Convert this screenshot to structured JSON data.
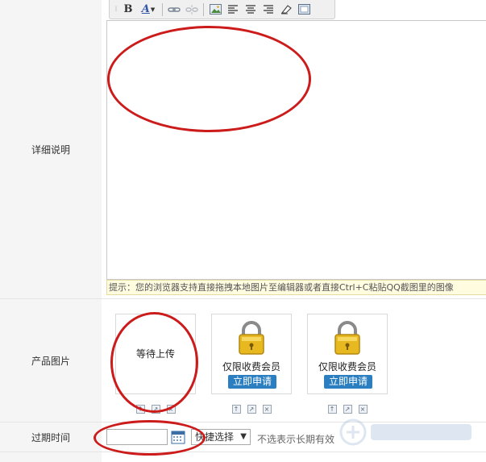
{
  "editor": {
    "toolbar": {
      "bold": "B",
      "font_color": "A",
      "icons": [
        "link-icon",
        "unlink-icon",
        "image-icon",
        "align-left-icon",
        "align-center-icon",
        "align-right-icon",
        "eraser-icon",
        "source-icon"
      ]
    },
    "hint": "提示：您的浏览器支持直接拖拽本地图片至编辑器或者直接Ctrl+C粘贴QQ截图里的图像"
  },
  "labels": {
    "detail": "详细说明",
    "product_images": "产品图片",
    "expire_time": "过期时间"
  },
  "images": [
    {
      "status": "等待上传"
    },
    {
      "text": "仅限收费会员",
      "button": "立即申请"
    },
    {
      "text": "仅限收费会员",
      "button": "立即申请"
    }
  ],
  "expire": {
    "date_value": "",
    "quick_select": "快捷选择",
    "note": "不选表示长期有效"
  },
  "colors": {
    "annotation_red": "#cc1b1b",
    "apply_button": "#2b7fc0",
    "label_bg": "#f5f5f5",
    "hint_bg": "#fffce0"
  }
}
